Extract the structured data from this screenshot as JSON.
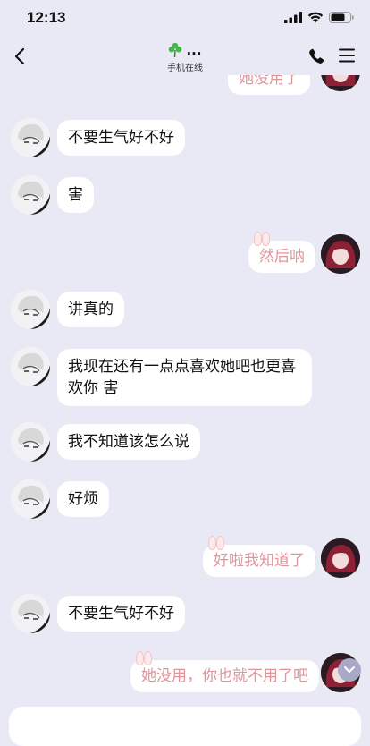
{
  "status_bar": {
    "time": "12:13"
  },
  "header": {
    "contact_name": "...",
    "status": "手机在线",
    "icons": [
      "chevron-left-icon",
      "clover-icon",
      "phone-icon",
      "menu-icon"
    ]
  },
  "messages": [
    {
      "side": "right",
      "text": "她没用了",
      "partial": true
    },
    {
      "side": "left",
      "text": "不要生气好不好"
    },
    {
      "side": "left",
      "text": "害"
    },
    {
      "side": "right",
      "text": "然后呐"
    },
    {
      "side": "left",
      "text": "讲真的"
    },
    {
      "side": "left",
      "text": "我现在还有一点点喜欢她吧也更喜欢你 害"
    },
    {
      "side": "left",
      "text": "我不知道该怎么说"
    },
    {
      "side": "left",
      "text": "好烦"
    },
    {
      "side": "right",
      "text": "好啦我知道了"
    },
    {
      "side": "left",
      "text": "不要生气好不好"
    },
    {
      "side": "right",
      "text": "她没用，你也就不用了吧"
    }
  ],
  "colors": {
    "background": "#e9e9f5",
    "left_bubble": "#ffffff",
    "right_text": "#e0959b"
  }
}
